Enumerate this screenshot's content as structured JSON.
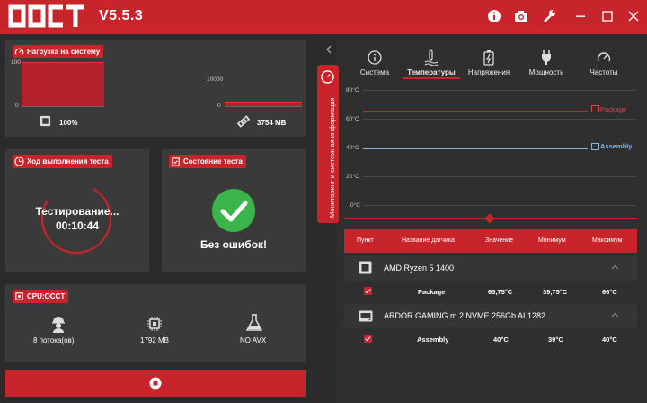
{
  "app": {
    "logo_text": "OCCT",
    "version": "V5.5.3"
  },
  "toolbar": {
    "icons": [
      "info-icon",
      "camera-icon",
      "wrench-icon",
      "minimize-icon",
      "maximize-icon",
      "close-icon"
    ]
  },
  "load_panel": {
    "title": "Нагрузка на систему",
    "cpu": {
      "axis": [
        "100",
        "0"
      ],
      "value_label": "100%",
      "level": 1.0
    },
    "memory": {
      "axis": [
        "10000",
        "0"
      ],
      "value_label": "3754 MB",
      "level": 0.375
    }
  },
  "progress_panel": {
    "title": "Ход выполнения теста",
    "status": "Тестирование...",
    "elapsed": "00:10:44"
  },
  "state_panel": {
    "title": "Состояние теста",
    "result": "Без ошибок!"
  },
  "cpu_panel": {
    "title": "CPU:OCCT",
    "threads": "8 потока(ов)",
    "memory": "1792 MB",
    "avx": "NO AVX"
  },
  "side_tab": {
    "label": "Мониторинг и системная информация"
  },
  "tabs": [
    {
      "label": "Система",
      "icon": "info-icon"
    },
    {
      "label": "Температуры",
      "icon": "thermometer-icon",
      "active": true
    },
    {
      "label": "Напряжения",
      "icon": "battery-icon"
    },
    {
      "label": "Мощность",
      "icon": "plug-icon"
    },
    {
      "label": "Частоты",
      "icon": "gauge-icon"
    }
  ],
  "chart": {
    "y_ticks": [
      "80°C",
      "60°C",
      "40°C",
      "20°C",
      "0°C"
    ],
    "series": [
      {
        "name": "Package",
        "value": 65.75,
        "color": "#c8242b"
      },
      {
        "name": "Assembly",
        "value": 40,
        "color": "#8ab4d8"
      }
    ]
  },
  "table": {
    "headers": [
      "Пункт",
      "Название датчика",
      "Значение",
      "Минимум",
      "Максимум"
    ],
    "devices": [
      {
        "name": "AMD Ryzen 5 1400",
        "sensor": {
          "name": "Package",
          "value": "65,75°C",
          "min": "39,75°C",
          "max": "66°C"
        }
      },
      {
        "name": "ARDOR GAMING m.2 NVME 256Gb AL1282",
        "sensor": {
          "name": "Assembly",
          "value": "40°C",
          "min": "39°C",
          "max": "40°C"
        }
      }
    ]
  },
  "colors": {
    "accent": "#c8242b",
    "panel": "#3a3a3a",
    "background": "#2b2b2b",
    "success": "#3bb54a"
  }
}
